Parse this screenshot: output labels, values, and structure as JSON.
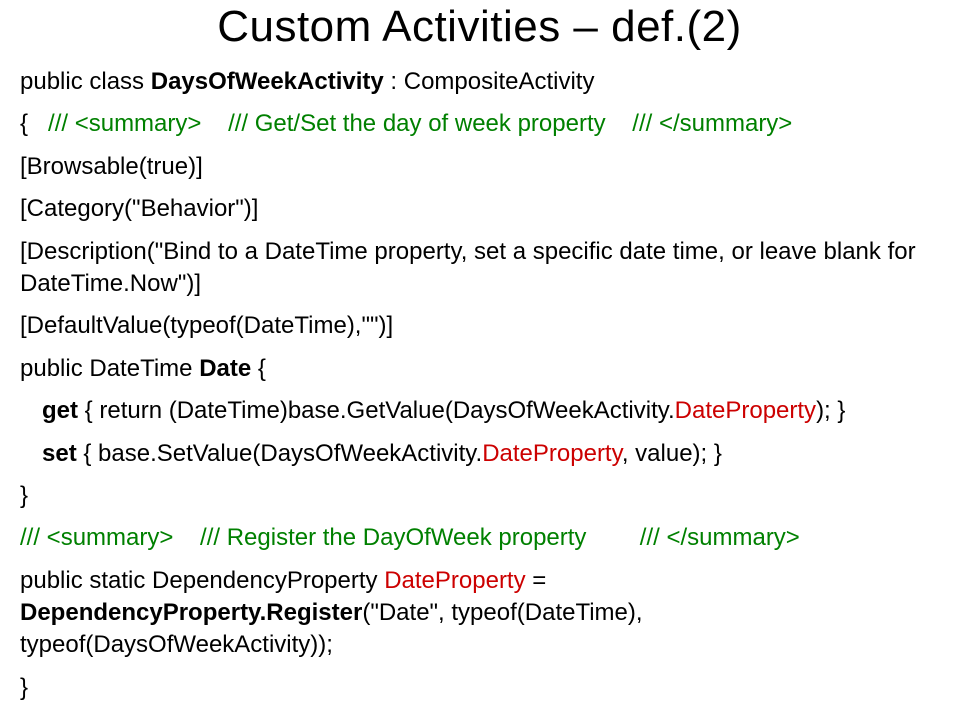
{
  "title": "Custom Activities – def.(2)",
  "line_class_decl_pre": "public class ",
  "line_class_decl_name": "DaysOfWeekActivity",
  "line_class_decl_post": " : CompositeActivity",
  "line_open_brace": "{",
  "line_sum1_open": "/// <summary>",
  "line_sum1_text": "/// Get/Set the day of week property",
  "line_sum1_close": "/// </summary>",
  "line_browsable": "[Browsable(true)]",
  "line_category": "[Category(\"Behavior\")]",
  "line_description": "[Description(\"Bind to a DateTime property, set a specific date time, or leave blank for DateTime.Now\")]",
  "line_defaultvalue": "[DefaultValue(typeof(DateTime),\"\")]",
  "line_prop_decl_pre": "public DateTime ",
  "line_prop_decl_name": "Date",
  "line_prop_decl_post": " {",
  "line_get_pre": "get",
  "line_get_mid": " { return (DateTime)base.GetValue(DaysOfWeekActivity.",
  "line_get_red": "DateProperty",
  "line_get_post": "); }",
  "line_set_pre": "set",
  "line_set_mid": " { base.SetValue(DaysOfWeekActivity.",
  "line_set_red": "DateProperty",
  "line_set_post": ", value); }",
  "line_close_brace1": "}",
  "line_sum2_open": "/// <summary>",
  "line_sum2_text": "/// Register the DayOfWeek property",
  "line_sum2_close": "/// </summary>",
  "line_static_pre": "public static DependencyProperty ",
  "line_static_name": "DateProperty",
  "line_static_post": " = ",
  "line_static_reg": "DependencyProperty.Register",
  "line_static_args": "(\"Date\", typeof(DateTime), typeof(DaysOfWeekActivity));",
  "line_close_brace2": "}"
}
